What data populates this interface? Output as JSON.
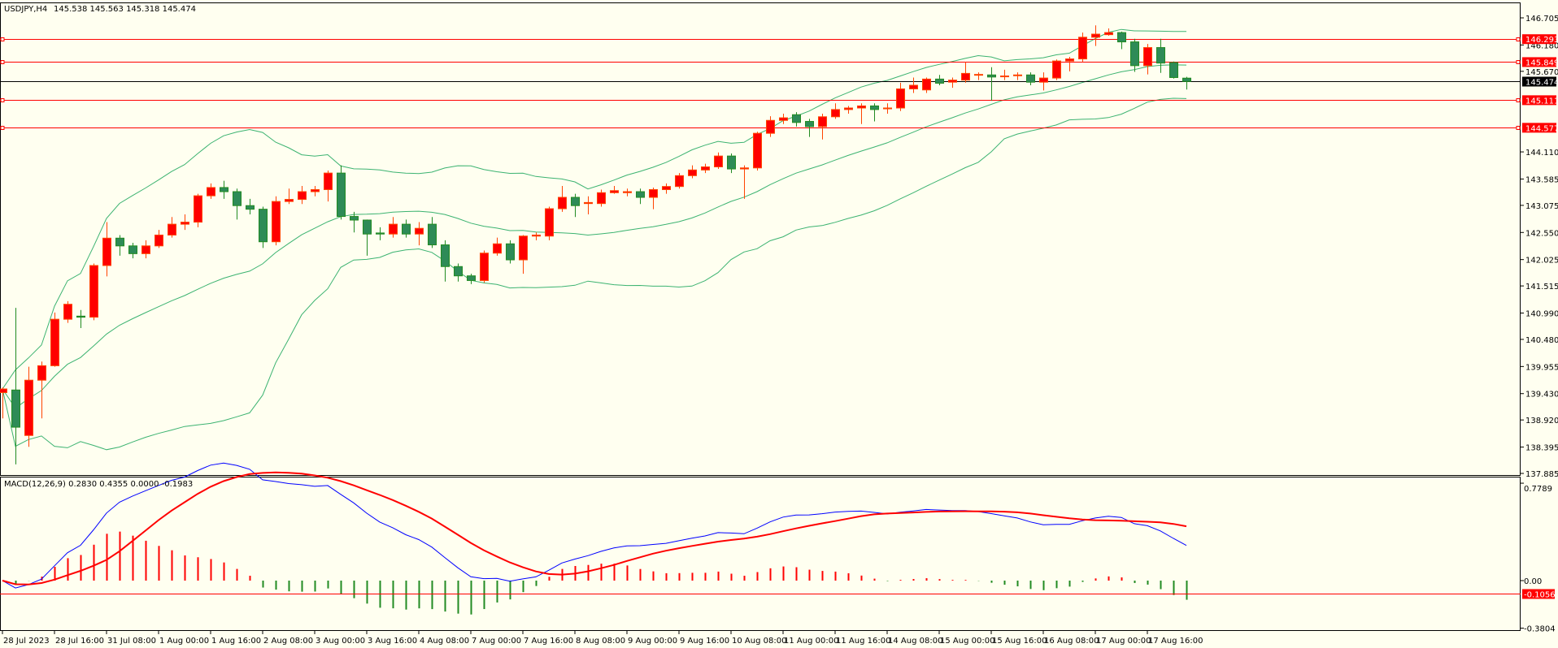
{
  "header": {
    "symbol": "USDJPY,H4",
    "ohlc": "145.538 145.563 145.318 145.474"
  },
  "macd_header": {
    "label": "MACD(12,26,9) 0.2830 0.4355 0.0000 -0.1983"
  },
  "colors": {
    "background": "#fffff0",
    "bull_fill": "#ff0000",
    "bull_border": "#ff4500",
    "bear_fill": "#2e8b57",
    "bear_border": "#228b22",
    "bands": "#3cb371",
    "level_line": "#ff0000",
    "bid_line": "#000000",
    "macd_line": "#0000ff",
    "signal_line": "#ff0000",
    "hist_pos": "#ff0000",
    "hist_neg": "#228b22"
  },
  "chart_data": {
    "type": "candlestick",
    "symbol": "USDJPY",
    "timeframe": "H4",
    "ylim": [
      137.885,
      146.705
    ],
    "price_ticks": [
      "146.705",
      "146.180",
      "145.670",
      "144.110",
      "143.585",
      "143.075",
      "142.550",
      "142.025",
      "141.515",
      "140.990",
      "140.480",
      "139.955",
      "139.430",
      "138.920",
      "138.395",
      "137.885"
    ],
    "time_labels": [
      "28 Jul 2023",
      "28 Jul 16:00",
      "31 Jul 08:00",
      "1 Aug 00:00",
      "1 Aug 16:00",
      "2 Aug 08:00",
      "3 Aug 00:00",
      "3 Aug 16:00",
      "4 Aug 08:00",
      "7 Aug 00:00",
      "7 Aug 16:00",
      "8 Aug 08:00",
      "9 Aug 00:00",
      "9 Aug 16:00",
      "10 Aug 08:00",
      "11 Aug 00:00",
      "11 Aug 16:00",
      "14 Aug 08:00",
      "15 Aug 00:00",
      "15 Aug 16:00",
      "16 Aug 08:00",
      "17 Aug 00:00",
      "17 Aug 16:00"
    ],
    "ohlc": [
      [
        139.45,
        139.55,
        138.95,
        139.52
      ],
      [
        139.5,
        141.09,
        138.06,
        138.78
      ],
      [
        138.62,
        139.95,
        138.4,
        139.69
      ],
      [
        139.69,
        140.05,
        138.95,
        139.97
      ],
      [
        139.97,
        141.0,
        139.95,
        140.87
      ],
      [
        140.87,
        141.22,
        140.8,
        141.16
      ],
      [
        140.93,
        141.05,
        140.7,
        140.91
      ],
      [
        140.91,
        141.95,
        140.85,
        141.91
      ],
      [
        141.91,
        142.75,
        141.7,
        142.44
      ],
      [
        142.44,
        142.5,
        142.1,
        142.29
      ],
      [
        142.29,
        142.35,
        142.05,
        142.14
      ],
      [
        142.14,
        142.4,
        142.05,
        142.29
      ],
      [
        142.29,
        142.6,
        142.25,
        142.5
      ],
      [
        142.5,
        142.85,
        142.45,
        142.71
      ],
      [
        142.71,
        142.9,
        142.6,
        142.75
      ],
      [
        142.75,
        143.3,
        142.65,
        143.26
      ],
      [
        143.26,
        143.5,
        143.2,
        143.42
      ],
      [
        143.42,
        143.55,
        143.2,
        143.34
      ],
      [
        143.34,
        143.4,
        142.8,
        143.07
      ],
      [
        143.07,
        143.2,
        142.9,
        143.0
      ],
      [
        143.0,
        143.05,
        142.25,
        142.37
      ],
      [
        142.37,
        143.25,
        142.3,
        143.15
      ],
      [
        143.15,
        143.4,
        143.1,
        143.19
      ],
      [
        143.19,
        143.45,
        143.1,
        143.34
      ],
      [
        143.34,
        143.45,
        143.25,
        143.38
      ],
      [
        143.38,
        143.75,
        143.15,
        143.7
      ],
      [
        143.7,
        143.85,
        142.8,
        142.86
      ],
      [
        142.86,
        142.95,
        142.55,
        142.79
      ],
      [
        142.79,
        142.8,
        142.1,
        142.52
      ],
      [
        142.54,
        142.65,
        142.4,
        142.52
      ],
      [
        142.52,
        142.85,
        142.45,
        142.71
      ],
      [
        142.71,
        142.8,
        142.45,
        142.52
      ],
      [
        142.52,
        142.75,
        142.3,
        142.63
      ],
      [
        142.71,
        142.85,
        142.25,
        142.31
      ],
      [
        142.31,
        142.4,
        141.6,
        141.89
      ],
      [
        141.89,
        141.95,
        141.6,
        141.71
      ],
      [
        141.71,
        141.75,
        141.55,
        141.62
      ],
      [
        141.62,
        142.2,
        141.58,
        142.15
      ],
      [
        142.15,
        142.45,
        142.1,
        142.33
      ],
      [
        142.33,
        142.4,
        141.95,
        142.02
      ],
      [
        142.02,
        142.5,
        141.75,
        142.48
      ],
      [
        142.48,
        142.55,
        142.4,
        142.5
      ],
      [
        142.48,
        143.05,
        142.4,
        143.01
      ],
      [
        143.01,
        143.45,
        142.95,
        143.23
      ],
      [
        143.23,
        143.3,
        142.85,
        143.07
      ],
      [
        143.11,
        143.25,
        142.9,
        143.13
      ],
      [
        143.11,
        143.38,
        143.05,
        143.32
      ],
      [
        143.32,
        143.45,
        143.3,
        143.36
      ],
      [
        143.32,
        143.4,
        143.25,
        143.34
      ],
      [
        143.34,
        143.4,
        143.1,
        143.23
      ],
      [
        143.23,
        143.42,
        143.0,
        143.38
      ],
      [
        143.38,
        143.5,
        143.3,
        143.44
      ],
      [
        143.44,
        143.7,
        143.4,
        143.65
      ],
      [
        143.65,
        143.85,
        143.6,
        143.76
      ],
      [
        143.76,
        143.88,
        143.7,
        143.82
      ],
      [
        143.82,
        144.1,
        143.78,
        144.03
      ],
      [
        144.03,
        144.08,
        143.7,
        143.78
      ],
      [
        143.78,
        143.85,
        143.2,
        143.8
      ],
      [
        143.8,
        144.5,
        143.75,
        144.47
      ],
      [
        144.47,
        144.8,
        144.4,
        144.72
      ],
      [
        144.72,
        144.85,
        144.65,
        144.77
      ],
      [
        144.83,
        144.88,
        144.6,
        144.68
      ],
      [
        144.7,
        144.75,
        144.4,
        144.6
      ],
      [
        144.6,
        144.85,
        144.35,
        144.79
      ],
      [
        144.79,
        145.05,
        144.75,
        144.93
      ],
      [
        144.93,
        145.0,
        144.85,
        144.96
      ],
      [
        144.96,
        145.05,
        144.65,
        145.0
      ],
      [
        145.0,
        145.05,
        144.7,
        144.93
      ],
      [
        144.95,
        145.05,
        144.85,
        144.96
      ],
      [
        144.96,
        145.45,
        144.9,
        145.33
      ],
      [
        145.33,
        145.55,
        145.25,
        145.4
      ],
      [
        145.31,
        145.55,
        145.25,
        145.52
      ],
      [
        145.52,
        145.6,
        145.4,
        145.44
      ],
      [
        145.46,
        145.55,
        145.35,
        145.5
      ],
      [
        145.5,
        145.85,
        145.45,
        145.63
      ],
      [
        145.6,
        145.65,
        145.5,
        145.61
      ],
      [
        145.6,
        145.75,
        145.1,
        145.56
      ],
      [
        145.58,
        145.7,
        145.5,
        145.58
      ],
      [
        145.59,
        145.65,
        145.5,
        145.6
      ],
      [
        145.6,
        145.65,
        145.4,
        145.46
      ],
      [
        145.46,
        145.65,
        145.3,
        145.54
      ],
      [
        145.54,
        145.9,
        145.5,
        145.87
      ],
      [
        145.87,
        145.95,
        145.67,
        145.91
      ],
      [
        145.91,
        146.42,
        145.85,
        146.33
      ],
      [
        146.33,
        146.56,
        146.16,
        146.39
      ],
      [
        146.38,
        146.5,
        146.36,
        146.42
      ],
      [
        146.42,
        146.44,
        146.1,
        146.24
      ],
      [
        146.24,
        146.3,
        145.66,
        145.78
      ],
      [
        145.78,
        146.2,
        145.61,
        146.13
      ],
      [
        146.13,
        146.3,
        145.64,
        145.83
      ],
      [
        145.84,
        145.86,
        145.53,
        145.55
      ],
      [
        145.538,
        145.563,
        145.318,
        145.474
      ]
    ],
    "levels": [
      "146.293",
      "145.849",
      "145.111",
      "144.577"
    ],
    "bid": "145.474",
    "bollinger": {
      "period": 20,
      "deviation": 2
    },
    "macd": {
      "fast": 12,
      "slow": 26,
      "signal": 9,
      "ylim": [
        -0.3804,
        0.7789
      ],
      "ticks": [
        "0.7789",
        "0.00",
        "-0.3804"
      ],
      "current_level": "-0.1056"
    }
  }
}
